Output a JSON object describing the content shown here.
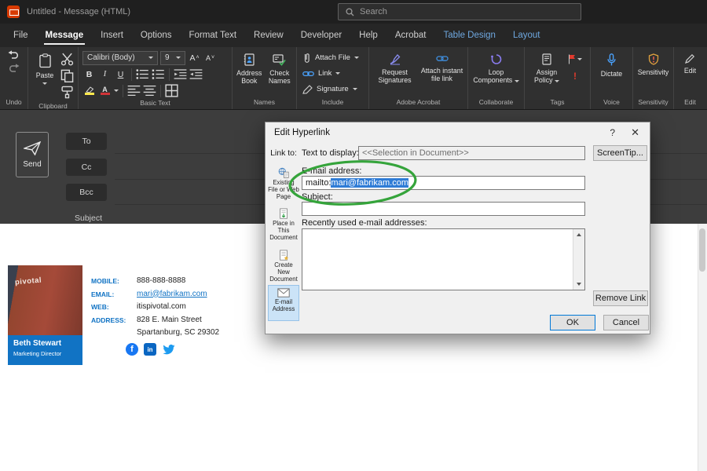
{
  "colors": {
    "annotation_green": "#35a43b",
    "signature_blue": "#1173c4",
    "contextual_tab_blue": "#6fa8e0",
    "selection_blue": "#2f7cd6",
    "default_button_border": "#0078d7",
    "flag_red": "#e23b2e",
    "link_icon_blue": "#4aa3ff"
  },
  "titlebar": {
    "title": "Untitled - Message (HTML)",
    "search": "Search"
  },
  "menubar": {
    "tabs": [
      {
        "label": "File"
      },
      {
        "label": "Message"
      },
      {
        "label": "Insert"
      },
      {
        "label": "Options"
      },
      {
        "label": "Format Text"
      },
      {
        "label": "Review"
      },
      {
        "label": "Developer"
      },
      {
        "label": "Help"
      },
      {
        "label": "Acrobat"
      },
      {
        "label": "Table Design"
      },
      {
        "label": "Layout"
      }
    ]
  },
  "ribbon": {
    "paste": "Paste",
    "font_name": "Calibri (Body)",
    "font_size": "9",
    "bold": "B",
    "italic": "I",
    "underline": "U",
    "font_glyph": "A",
    "address_book": "Address Book",
    "check_names": "Check Names",
    "attach_file": "Attach File",
    "link": "Link",
    "signature": "Signature",
    "request_signatures": "Request Signatures",
    "attach_instant": "Attach instant file link",
    "loop_components": "Loop Components",
    "assign_policy": "Assign Policy",
    "important_mark": "!",
    "dictate": "Dictate",
    "sensitivity": "Sensitivity",
    "edit": "Edit",
    "groups": {
      "undo": "Undo",
      "clipboard": "Clipboard",
      "basic_text": "Basic Text",
      "names": "Names",
      "include": "Include",
      "adobe": "Adobe Acrobat",
      "collaborate": "Collaborate",
      "tags": "Tags",
      "voice": "Voice",
      "sensitivity": "Sensitivity",
      "edit": "Edit"
    }
  },
  "compose": {
    "send": "Send",
    "to": "To",
    "cc": "Cc",
    "bcc": "Bcc",
    "subject": "Subject"
  },
  "signature": {
    "photo_brand": "pivotal",
    "name": "Beth Stewart",
    "role": "Marketing Director",
    "rows": [
      {
        "label": "MOBILE:",
        "value": "888-888-8888"
      },
      {
        "label": "EMAIL:",
        "value": "mari@fabrikam.com"
      },
      {
        "label": "WEB:",
        "value": "itispivotal.com"
      },
      {
        "label": "ADDRESS:",
        "value": "828 E. Main Street"
      },
      {
        "label": "",
        "value": "Spartanburg, SC 29302"
      }
    ],
    "social": {
      "facebook": "f",
      "linkedin": "in"
    }
  },
  "dialog": {
    "title": "Edit Hyperlink",
    "help": "?",
    "close": "✕",
    "link_to": "Link to:",
    "sidebar": [
      {
        "label": "Existing File or Web Page"
      },
      {
        "label": "Place in This Document"
      },
      {
        "label": "Create New Document"
      },
      {
        "label": "E-mail Address"
      }
    ],
    "text_to_display": "Text to display:",
    "text_to_display_value": "<<Selection in Document>>",
    "screentip": "ScreenTip...",
    "email_label": "E-mail address:",
    "email_prefix": "mailto:",
    "email_value": "mari@fabrikam.com",
    "subject_label": "Subject:",
    "recent_label": "Recently used e-mail addresses:",
    "remove_link": "Remove Link",
    "ok": "OK",
    "cancel": "Cancel"
  }
}
